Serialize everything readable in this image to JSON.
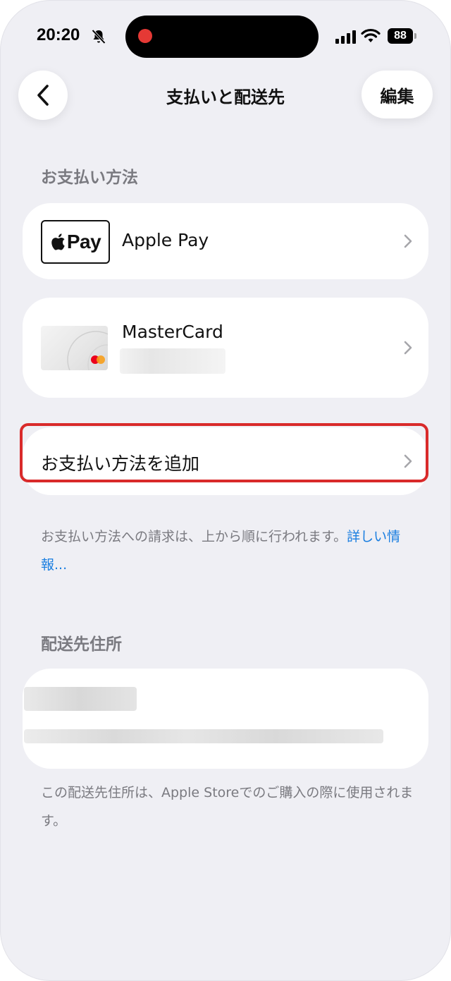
{
  "status_bar": {
    "time": "20:20",
    "battery_level": "88"
  },
  "nav": {
    "title": "支払いと配送先",
    "edit_label": "編集"
  },
  "payment": {
    "section_title": "お支払い方法",
    "apple_pay": {
      "logo_text": "Pay",
      "label": "Apple Pay"
    },
    "mastercard": {
      "label": "MasterCard",
      "thumb_brand": "mastercard"
    },
    "add_label": "お支払い方法を追加",
    "note_text": "お支払い方法への請求は、上から順に行われます。",
    "note_link": "詳しい情報..."
  },
  "shipping": {
    "section_title": "配送先住所",
    "note_text": "この配送先住所は、Apple Storeでのご購入の際に使用されます。"
  },
  "colors": {
    "accent_link": "#1a7ee0",
    "highlight": "#d92a2a",
    "background": "#efeff4"
  }
}
